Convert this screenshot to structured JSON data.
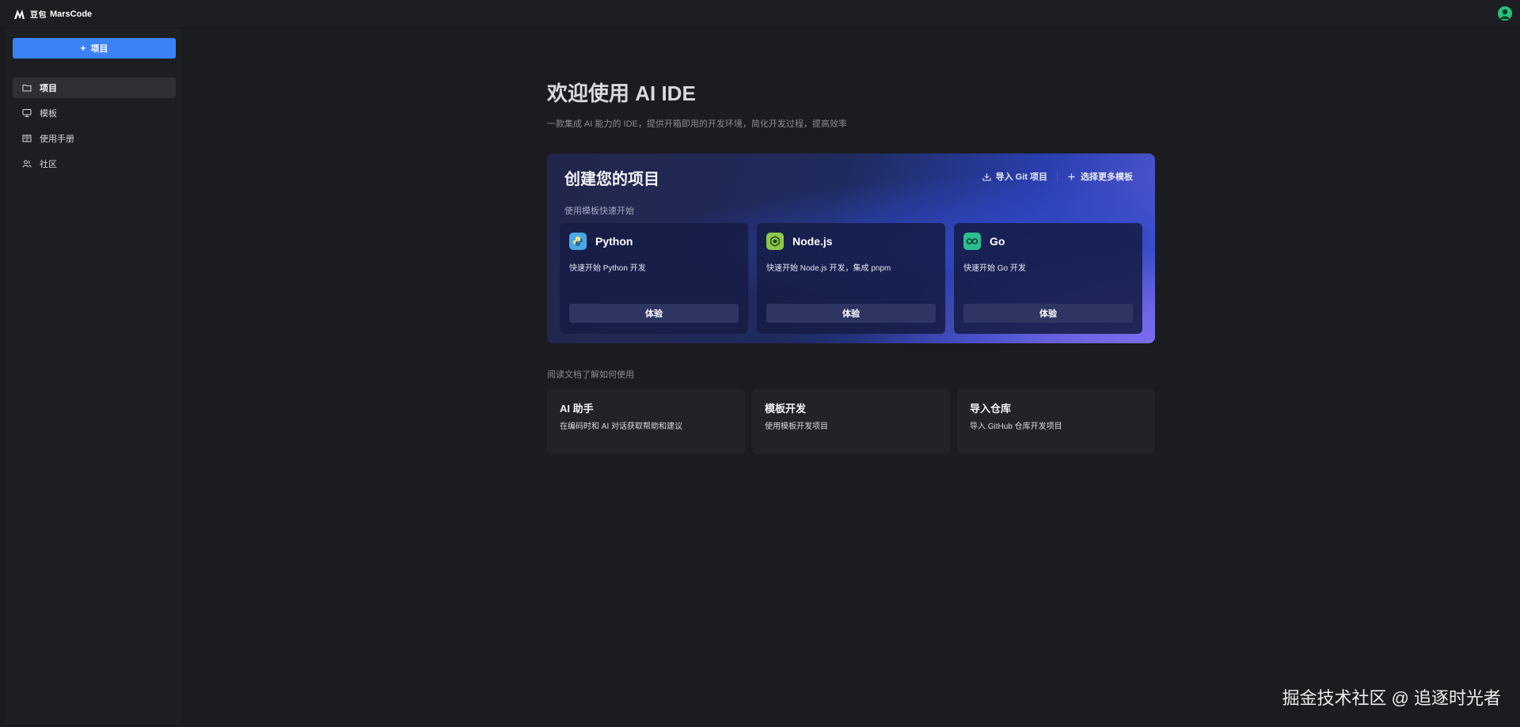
{
  "app": {
    "brand_cn": "豆包",
    "brand_en": "MarsCode"
  },
  "sidebar": {
    "new_button": "项目",
    "items": [
      {
        "label": "项目",
        "icon": "folder-icon",
        "active": true
      },
      {
        "label": "模板",
        "icon": "monitor-icon",
        "active": false
      },
      {
        "label": "使用手册",
        "icon": "book-icon",
        "active": false
      },
      {
        "label": "社区",
        "icon": "users-icon",
        "active": false
      }
    ]
  },
  "main": {
    "title": "欢迎使用 AI IDE",
    "subtitle": "一款集成 AI 能力的 IDE，提供开箱即用的开发环境，简化开发过程，提高效率",
    "hero": {
      "title": "创建您的项目",
      "import_git": "导入 Git 项目",
      "more_templates": "选择更多模板",
      "hint": "使用模板快速开始",
      "templates": [
        {
          "name": "Python",
          "desc": "快速开始 Python 开发",
          "button": "体验",
          "icon": "python-icon",
          "color": "#4aa8e8"
        },
        {
          "name": "Node.js",
          "desc": "快速开始 Node.js 开发，集成 pnpm",
          "button": "体验",
          "icon": "nodejs-icon",
          "color": "#8cc84b"
        },
        {
          "name": "Go",
          "desc": "快速开始 Go 开发",
          "button": "体验",
          "icon": "go-icon",
          "color": "#2bbf8f"
        }
      ]
    },
    "docs": {
      "label": "阅读文档了解如何使用",
      "cards": [
        {
          "title": "AI 助手",
          "desc": "在编码时和 AI 对话获取帮助和建议"
        },
        {
          "title": "模板开发",
          "desc": "使用模板开发项目"
        },
        {
          "title": "导入仓库",
          "desc": "导入 GitHub 仓库开发项目"
        }
      ]
    }
  },
  "watermark": "掘金技术社区 @ 追逐时光者",
  "colors": {
    "accent": "#3b82f6",
    "background": "#1a1b1f",
    "panel": "#1d1e22",
    "card": "#222327"
  }
}
